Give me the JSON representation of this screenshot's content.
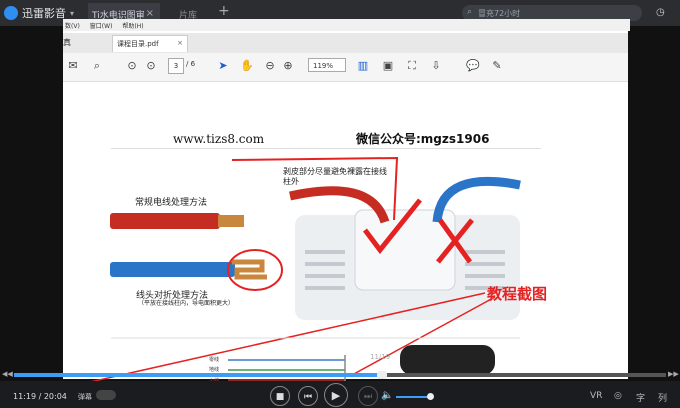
{
  "app": {
    "name": "迅雷影音",
    "caret": "▾"
  },
  "tabs": [
    {
      "label": "Ti水电识图审",
      "close": "×"
    },
    {
      "label": "片库"
    }
  ],
  "new_tab": "+",
  "search": {
    "placeholder": "冒充72小时",
    "icon": "search-icon"
  },
  "pdf": {
    "menu": [
      "窗口(W)",
      "帮助(H)"
    ],
    "menu_prefix": "数(V)",
    "tab_edge": "真",
    "doc_tab": {
      "label": "课程目录.pdf",
      "close": "×"
    },
    "page": {
      "current": "3",
      "total": "/ 6"
    },
    "zoom": "119%"
  },
  "document": {
    "site": "www.tizs8.com",
    "wechat": "微信公众号:mgzs1906",
    "label_normal": "常规电线处理方法",
    "label_fold": "线头对折处理方法",
    "label_fold_sub": "（平放在接线柱内，导电面积更大）",
    "label_strip": "剥皮部分尽量避免裸露在接线柱外",
    "annotation": "教程截图",
    "wire_labels": [
      "零线",
      "地线",
      "火线"
    ],
    "page_num": "11/19"
  },
  "player": {
    "time": "11:19 / 20:04",
    "danmu": "弹幕",
    "progress": 0.564,
    "volume": 0.9,
    "right_buttons": [
      "VR",
      "字",
      "列"
    ]
  },
  "colors": {
    "accent": "#3e9cf4",
    "red": "#e52222",
    "topbar": "#2b2d31"
  }
}
